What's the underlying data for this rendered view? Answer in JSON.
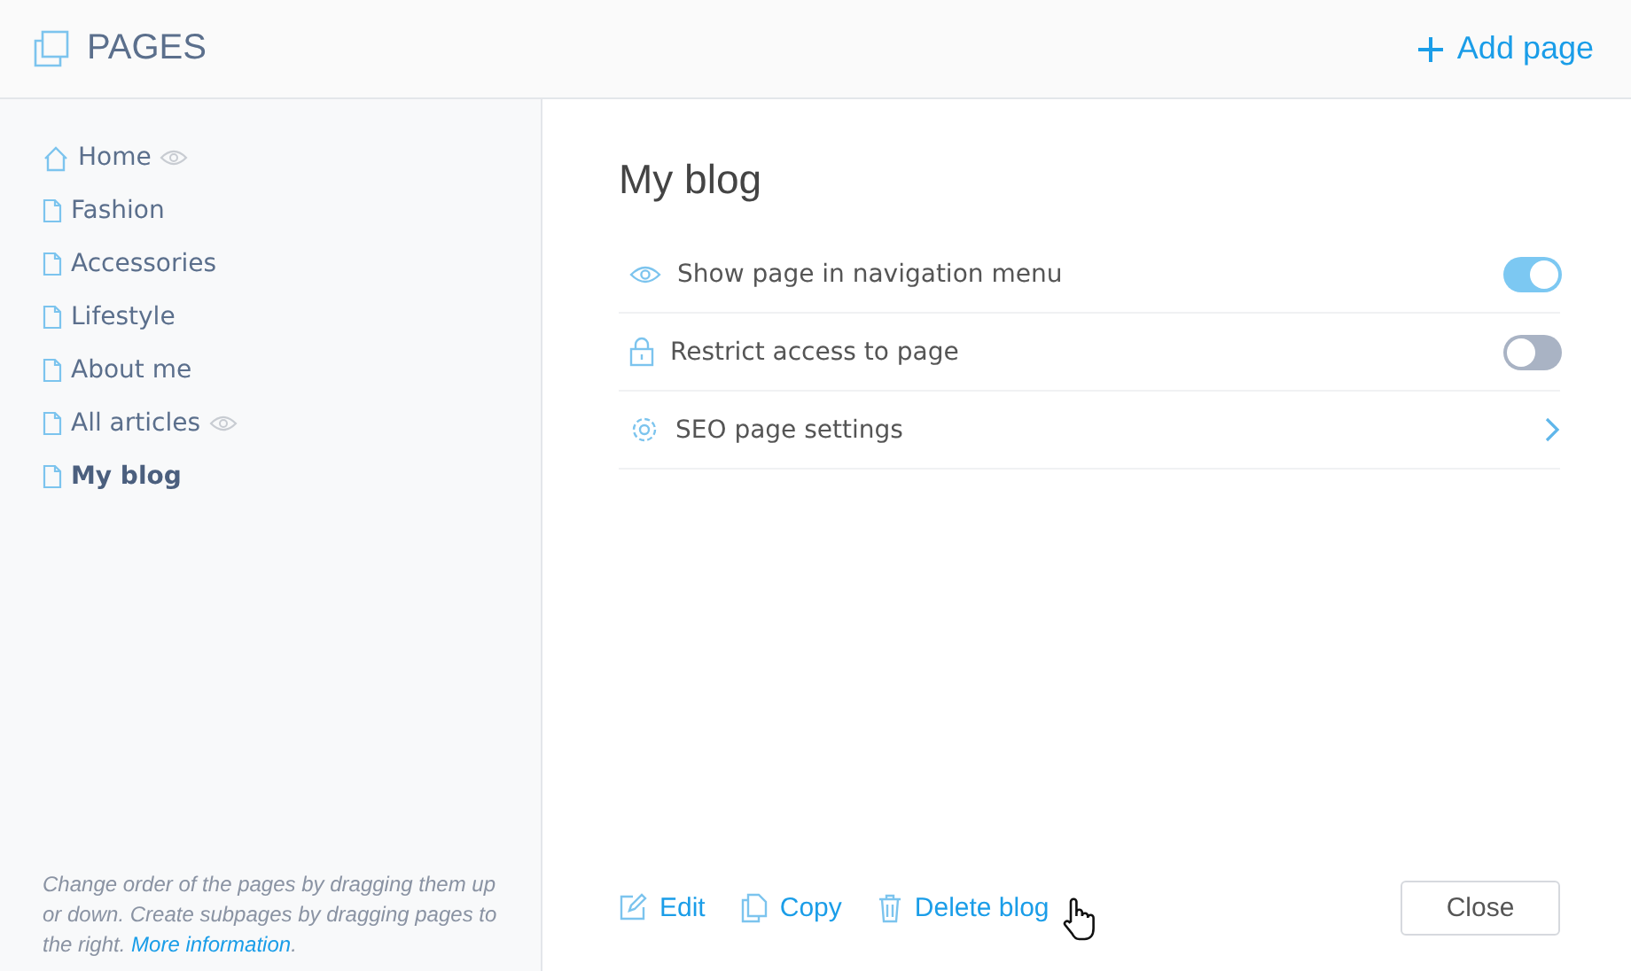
{
  "header": {
    "title": "PAGES",
    "add_button": "Add page"
  },
  "pages": [
    {
      "label": "Home",
      "kind": "home",
      "eye": true,
      "selected": false
    },
    {
      "label": "Fashion",
      "kind": "page",
      "eye": false,
      "selected": false
    },
    {
      "label": "Accessories",
      "kind": "page",
      "eye": false,
      "selected": false
    },
    {
      "label": "Lifestyle",
      "kind": "page",
      "eye": false,
      "selected": false
    },
    {
      "label": "About me",
      "kind": "page",
      "eye": false,
      "selected": false
    },
    {
      "label": "All articles",
      "kind": "page",
      "eye": true,
      "selected": false
    },
    {
      "label": "My blog",
      "kind": "page",
      "eye": false,
      "selected": true
    }
  ],
  "sidebar_hint": {
    "text": "Change order of the pages by dragging them up or down. Create subpages by dragging pages to the right.",
    "link": "More information",
    "end": "."
  },
  "detail": {
    "title": "My blog",
    "settings": [
      {
        "label": "Show page in navigation menu",
        "kind": "toggle",
        "on": true
      },
      {
        "label": "Restrict access to page",
        "kind": "toggle",
        "on": false
      },
      {
        "label": "SEO page settings",
        "kind": "link"
      }
    ],
    "actions": [
      {
        "label": "Edit"
      },
      {
        "label": "Copy"
      },
      {
        "label": "Delete blog"
      }
    ],
    "close_button": "Close"
  }
}
